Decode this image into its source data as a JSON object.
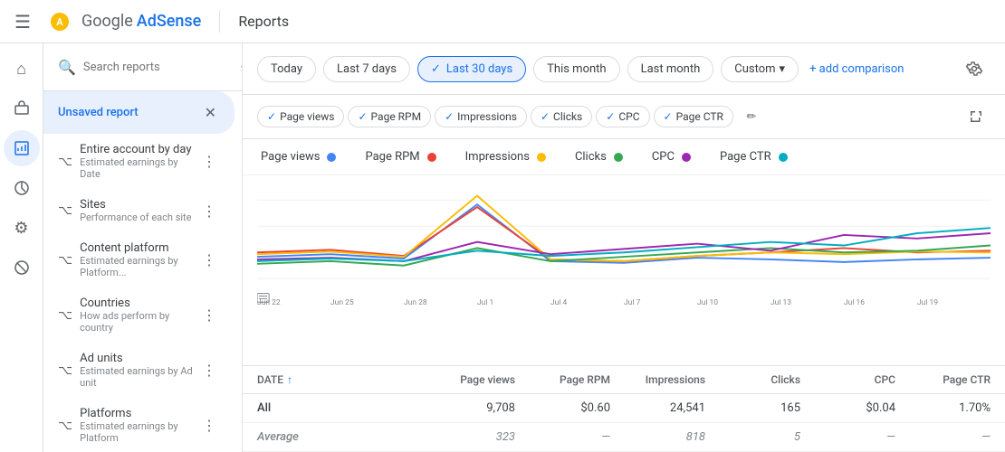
{
  "header": {
    "menu_icon": "☰",
    "brand_google": "Google",
    "brand_adsense": "AdSense",
    "page_title": "Reports"
  },
  "date_filters": {
    "today": "Today",
    "last7": "Last 7 days",
    "last30": "Last 30 days",
    "this_month": "This month",
    "last_month": "Last month",
    "custom": "Custom",
    "add_comparison": "+ add comparison",
    "active": "last30"
  },
  "nav_icons": [
    {
      "name": "home-icon",
      "icon": "⌂"
    },
    {
      "name": "dollar-icon",
      "icon": "$"
    },
    {
      "name": "chart-icon",
      "icon": "📊"
    },
    {
      "name": "person-icon",
      "icon": "👤"
    },
    {
      "name": "grid-icon",
      "icon": "⚏"
    },
    {
      "name": "trend-icon",
      "icon": "📈"
    },
    {
      "name": "settings-icon",
      "icon": "⚙"
    },
    {
      "name": "block-icon",
      "icon": "⊞"
    },
    {
      "name": "help-icon",
      "icon": "?"
    }
  ],
  "sidebar": {
    "search_placeholder": "Search reports",
    "items": [
      {
        "id": "unsaved",
        "icon": "",
        "title": "Unsaved report",
        "subtitle": "",
        "active": true,
        "closable": true
      },
      {
        "id": "entire-account",
        "icon": "~",
        "title": "Entire account by day",
        "subtitle": "Estimated earnings by Date",
        "active": false,
        "closable": false
      },
      {
        "id": "sites",
        "icon": "~",
        "title": "Sites",
        "subtitle": "Performance of each site",
        "active": false,
        "closable": false
      },
      {
        "id": "content-platform",
        "icon": "~",
        "title": "Content platform",
        "subtitle": "Estimated earnings by Platform...",
        "active": false,
        "closable": false
      },
      {
        "id": "countries",
        "icon": "~",
        "title": "Countries",
        "subtitle": "How ads perform by country",
        "active": false,
        "closable": false
      },
      {
        "id": "ad-units",
        "icon": "~",
        "title": "Ad units",
        "subtitle": "Estimated earnings by Ad unit",
        "active": false,
        "closable": false
      },
      {
        "id": "platforms",
        "icon": "~",
        "title": "Platforms",
        "subtitle": "Estimated earnings by Platform",
        "active": false,
        "closable": false
      }
    ]
  },
  "metrics": {
    "chips": [
      {
        "label": "Page views",
        "color": "#4285f4",
        "checked": true
      },
      {
        "label": "Page RPM",
        "color": "#ea4335",
        "checked": true
      },
      {
        "label": "Impressions",
        "color": "#fbbc04",
        "checked": true
      },
      {
        "label": "Clicks",
        "color": "#34a853",
        "checked": true
      },
      {
        "label": "CPC",
        "color": "#9c27b0",
        "checked": true
      },
      {
        "label": "Page CTR",
        "color": "#00acc1",
        "checked": true
      }
    ]
  },
  "legend": [
    {
      "label": "Page views",
      "color": "#4285f4"
    },
    {
      "label": "Page RPM",
      "color": "#ea4335"
    },
    {
      "label": "Impressions",
      "color": "#fbbc04"
    },
    {
      "label": "Clicks",
      "color": "#34a853"
    },
    {
      "label": "CPC",
      "color": "#9c27b0"
    },
    {
      "label": "Page CTR",
      "color": "#00acc1"
    }
  ],
  "chart": {
    "x_labels": [
      "Jun 22",
      "Jun 25",
      "Jun 28",
      "Jul 1",
      "Jul 4",
      "Jul 7",
      "Jul 10",
      "Jul 13",
      "Jul 16",
      "Jul 19"
    ],
    "series": {
      "page_views": [
        55,
        52,
        48,
        90,
        45,
        42,
        50,
        48,
        44,
        46
      ],
      "page_rpm": [
        48,
        50,
        45,
        85,
        40,
        38,
        44,
        52,
        55,
        50
      ],
      "impressions": [
        52,
        55,
        50,
        120,
        48,
        44,
        50,
        55,
        52,
        56
      ],
      "clicks": [
        42,
        44,
        40,
        60,
        45,
        50,
        55,
        60,
        55,
        58
      ],
      "cpc": [
        50,
        52,
        48,
        65,
        55,
        60,
        65,
        58,
        70,
        65
      ],
      "page_ctr": [
        45,
        48,
        46,
        55,
        50,
        55,
        60,
        62,
        68,
        75
      ]
    }
  },
  "table": {
    "headers": [
      "DATE",
      "Page views",
      "Page RPM",
      "Impressions",
      "Clicks",
      "CPC",
      "Page CTR"
    ],
    "sort_col": "DATE",
    "sort_dir": "asc",
    "rows": [
      {
        "date": "All",
        "page_views": "9,708",
        "page_rpm": "$0.60",
        "impressions": "24,541",
        "clicks": "165",
        "cpc": "$0.04",
        "page_ctr": "1.70%"
      },
      {
        "date": "Average",
        "page_views": "323",
        "page_rpm": "—",
        "impressions": "818",
        "clicks": "5",
        "cpc": "—",
        "page_ctr": "—"
      }
    ]
  }
}
